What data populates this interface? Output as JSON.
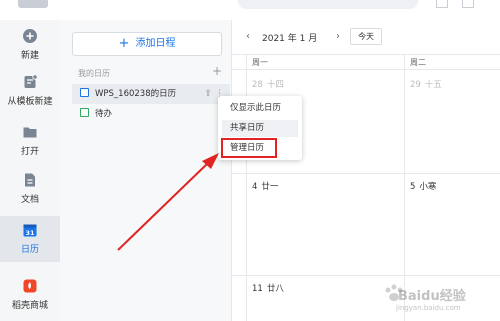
{
  "nav": {
    "items": [
      {
        "label": "新建",
        "icon": "plus-circle-icon"
      },
      {
        "label": "从模板新建",
        "icon": "template-icon"
      },
      {
        "label": "打开",
        "icon": "folder-icon"
      },
      {
        "label": "文档",
        "icon": "document-icon"
      },
      {
        "label": "日历",
        "icon": "calendar-icon",
        "badge": "31",
        "active": true
      },
      {
        "label": "稻壳商城",
        "icon": "docer-store-icon"
      }
    ]
  },
  "panel": {
    "add_label": "添加日程",
    "section_title": "我的日历",
    "calendars": [
      {
        "name": "WPS_160238的日历",
        "color": "#1a73e8"
      },
      {
        "name": "待办",
        "color": "#2eab61"
      }
    ]
  },
  "calendar": {
    "month_label": "2021 年 1 月",
    "today_label": "今天",
    "weekdays": [
      "周一",
      "周二"
    ],
    "days": [
      {
        "date": "28",
        "lunar": "十四"
      },
      {
        "date": "29",
        "lunar": "十五"
      },
      {
        "date": "4",
        "lunar": "廿一"
      },
      {
        "date": "5",
        "lunar": "小寒"
      },
      {
        "date": "11",
        "lunar": "廿八"
      }
    ]
  },
  "context_menu": {
    "items": [
      "仅显示此日历",
      "共享日历",
      "管理日历"
    ]
  },
  "watermark": {
    "text": "Baidu经验",
    "sub": "jingyan.baidu.com"
  },
  "colors": {
    "accent": "#1a73e8",
    "highlight_red": "#e02424"
  }
}
